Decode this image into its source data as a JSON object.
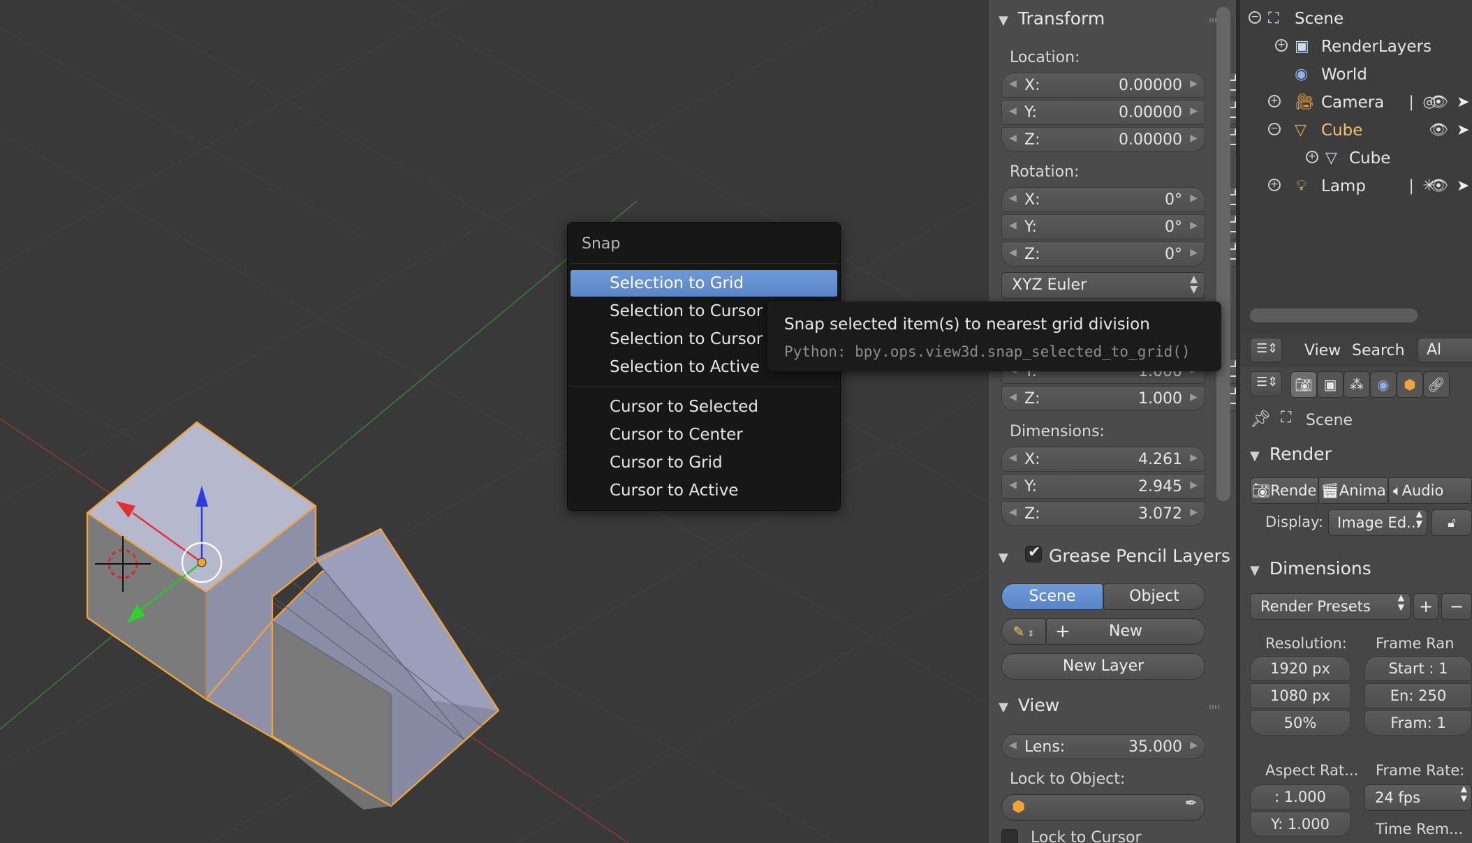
{
  "colors": {
    "selection_blue": "#5f8bcc",
    "object_outline": "#f2a43a",
    "viewport_bg": "#393939"
  },
  "snap_menu": {
    "title": "Snap",
    "items": [
      {
        "label": "Selection to Grid",
        "active": true
      },
      {
        "label": "Selection to Cursor"
      },
      {
        "label": "Selection to Cursor (Offset)"
      },
      {
        "label": "Selection to Active"
      },
      {
        "label": "Cursor to Selected"
      },
      {
        "label": "Cursor to Center"
      },
      {
        "label": "Cursor to Grid"
      },
      {
        "label": "Cursor to Active"
      }
    ]
  },
  "tooltip": {
    "description": "Snap selected item(s) to nearest grid division",
    "python": "Python: bpy.ops.view3d.snap_selected_to_grid()"
  },
  "transform": {
    "title": "Transform",
    "location_label": "Location:",
    "location": [
      {
        "axis": "X:",
        "value": "0.00000"
      },
      {
        "axis": "Y:",
        "value": "0.00000"
      },
      {
        "axis": "Z:",
        "value": "0.00000"
      }
    ],
    "rotation_label": "Rotation:",
    "rotation": [
      {
        "axis": "X:",
        "value": "0°"
      },
      {
        "axis": "Y:",
        "value": "0°"
      },
      {
        "axis": "Z:",
        "value": "0°"
      }
    ],
    "rotation_mode": "XYZ Euler",
    "scale": [
      {
        "axis": "Y:",
        "value": "1.000"
      },
      {
        "axis": "Z:",
        "value": "1.000"
      }
    ],
    "dimensions_label": "Dimensions:",
    "dimensions": [
      {
        "axis": "X:",
        "value": "4.261"
      },
      {
        "axis": "Y:",
        "value": "2.945"
      },
      {
        "axis": "Z:",
        "value": "3.072"
      }
    ]
  },
  "grease_pencil": {
    "title": "Grease Pencil Layers",
    "checked": true,
    "scene_btn": "Scene",
    "object_btn": "Object",
    "new_btn": "New",
    "new_layer_btn": "New Layer"
  },
  "view_panel": {
    "title": "View",
    "lens_label": "Lens:",
    "lens_value": "35.000",
    "lock_object_label": "Lock to Object:",
    "lock_cursor_label": "Lock to Cursor"
  },
  "outliner": {
    "rows": [
      {
        "label": "Scene",
        "icon": "scene-icon"
      },
      {
        "label": "RenderLayers",
        "icon": "render-layers-icon"
      },
      {
        "label": "World",
        "icon": "world-icon"
      },
      {
        "label": "Camera",
        "icon": "camera-icon"
      },
      {
        "label": "Cube",
        "icon": "mesh-object-icon"
      },
      {
        "label": "Cube",
        "icon": "mesh-data-icon"
      },
      {
        "label": "Lamp",
        "icon": "lamp-icon"
      }
    ]
  },
  "properties": {
    "header": {
      "view": "View",
      "search": "Search",
      "all": "Al"
    },
    "scene_label": "Scene",
    "render": {
      "title": "Render",
      "buttons": [
        "Rende",
        "Anima",
        "Audio"
      ],
      "display_label": "Display:",
      "display_value": "Image Ed..."
    },
    "dimensions": {
      "title": "Dimensions",
      "presets": "Render Presets",
      "resolution_label": "Resolution:",
      "res_x": "1920 px",
      "res_y": "1080 px",
      "res_pct": "50%",
      "frame_range_label": "Frame Ran",
      "start": "Start : 1",
      "end": "En: 250",
      "frame": "Fram: 1",
      "aspect_label": "Aspect Rat...",
      "aspect_x": ":  1.000",
      "aspect_y": "Y: 1.000",
      "frame_rate_label": "Frame Rate:",
      "fps": "24 fps",
      "time_remap_label": "Time Rem..."
    }
  }
}
